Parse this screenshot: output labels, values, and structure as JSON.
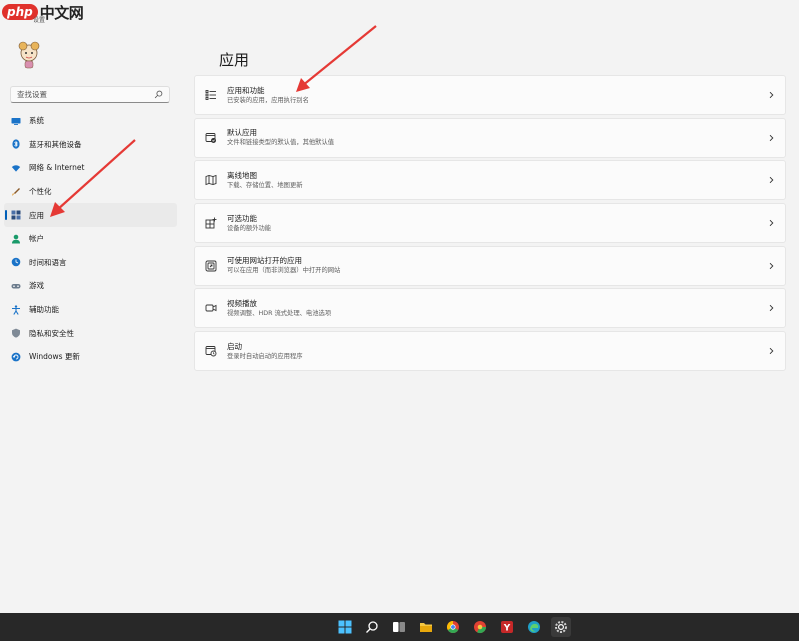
{
  "watermark": {
    "brand": "php",
    "site": "中文网"
  },
  "window": {
    "title": "设置"
  },
  "search": {
    "placeholder": "查找设置"
  },
  "sidebar": {
    "items": [
      {
        "label": "系统",
        "icon": "monitor-icon",
        "active": false
      },
      {
        "label": "蓝牙和其他设备",
        "icon": "bluetooth-icon",
        "active": false
      },
      {
        "label": "网络 & Internet",
        "icon": "wifi-icon",
        "active": false
      },
      {
        "label": "个性化",
        "icon": "brush-icon",
        "active": false
      },
      {
        "label": "应用",
        "icon": "apps-icon",
        "active": true
      },
      {
        "label": "帐户",
        "icon": "person-icon",
        "active": false
      },
      {
        "label": "时间和语言",
        "icon": "globe-clock-icon",
        "active": false
      },
      {
        "label": "游戏",
        "icon": "gamepad-icon",
        "active": false
      },
      {
        "label": "辅助功能",
        "icon": "accessibility-icon",
        "active": false
      },
      {
        "label": "隐私和安全性",
        "icon": "shield-icon",
        "active": false
      },
      {
        "label": "Windows 更新",
        "icon": "update-icon",
        "active": false
      }
    ]
  },
  "main": {
    "title": "应用",
    "cards": [
      {
        "title": "应用和功能",
        "subtitle": "已安装的应用，应用执行别名",
        "icon": "list-icon"
      },
      {
        "title": "默认应用",
        "subtitle": "文件和链接类型的默认值，其他默认值",
        "icon": "default-app-icon"
      },
      {
        "title": "离线地图",
        "subtitle": "下载、存储位置、地图更新",
        "icon": "map-icon"
      },
      {
        "title": "可选功能",
        "subtitle": "设备的额外功能",
        "icon": "add-feature-icon"
      },
      {
        "title": "可使用网站打开的应用",
        "subtitle": "可以在应用（而非浏览器）中打开的网站",
        "icon": "web-app-icon"
      },
      {
        "title": "视频播放",
        "subtitle": "视频调整、HDR 流式处理、电池选项",
        "icon": "video-icon"
      },
      {
        "title": "启动",
        "subtitle": "登录时自动启动的应用程序",
        "icon": "startup-icon"
      }
    ]
  },
  "colors": {
    "accent": "#005fb8",
    "arrow": "#e53935",
    "taskbar": "#282828",
    "background": "#f3f3f3"
  },
  "taskbar": {
    "icons": [
      "start-icon",
      "search-icon",
      "task-view-icon",
      "file-explorer-icon",
      "chrome-icon",
      "browser-icon",
      "app-icon",
      "edge-icon",
      "settings-icon"
    ]
  }
}
